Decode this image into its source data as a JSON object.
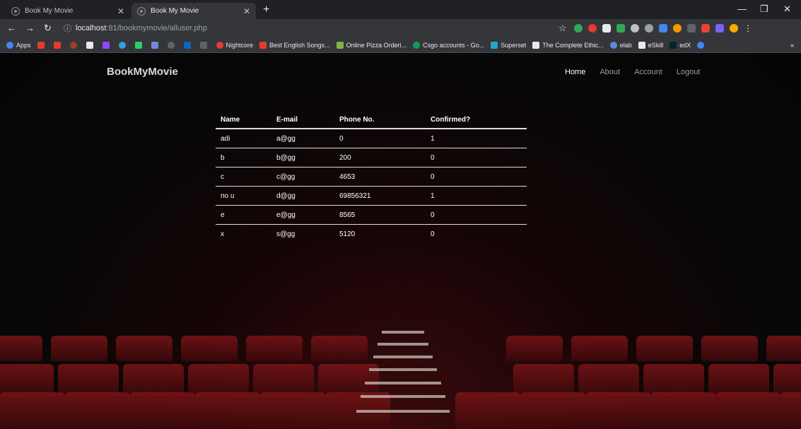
{
  "browser": {
    "tabs": [
      {
        "title": "Book My Movie",
        "active": false
      },
      {
        "title": "Book My Movie",
        "active": true
      }
    ],
    "url_host": "localhost",
    "url_path": ":81/bookmymovie/alluser.php",
    "bookmarks": [
      {
        "label": "Apps",
        "color": "#4285f4"
      },
      {
        "label": "",
        "color": "#e53935"
      },
      {
        "label": "",
        "color": "#e53935"
      },
      {
        "label": "",
        "color": "#9e3e29"
      },
      {
        "label": "",
        "color": "#e8eaed"
      },
      {
        "label": "",
        "color": "#9147ff"
      },
      {
        "label": "",
        "color": "#2aa3e1"
      },
      {
        "label": "",
        "color": "#25d366"
      },
      {
        "label": "",
        "color": "#7289da"
      },
      {
        "label": "",
        "color": "#5f6368"
      },
      {
        "label": "",
        "color": "#0a66c2"
      },
      {
        "label": "",
        "color": "#5f6368"
      },
      {
        "label": "Nightcore",
        "color": "#e53935"
      },
      {
        "label": "Best English Songs...",
        "color": "#e53935"
      },
      {
        "label": "Online Pizza Orderi...",
        "color": "#7cb342"
      },
      {
        "label": "Csgo accounts - Go...",
        "color": "#0f9d58"
      },
      {
        "label": "Superset",
        "color": "#20a7c9"
      },
      {
        "label": "The Complete Ethic...",
        "color": "#e8eaed"
      },
      {
        "label": "elab",
        "color": "#5c8bd6"
      },
      {
        "label": "eSkill",
        "color": "#e8eaed"
      },
      {
        "label": "edX",
        "color": "#02262b"
      },
      {
        "label": "",
        "color": "#4285f4"
      }
    ],
    "bookmarks_more": "»"
  },
  "site": {
    "brand": "BookMyMovie",
    "nav": [
      {
        "label": "Home",
        "active": true
      },
      {
        "label": "About",
        "active": false
      },
      {
        "label": "Account",
        "active": false
      },
      {
        "label": "Logout",
        "active": false
      }
    ]
  },
  "users_table": {
    "headers": [
      "Name",
      "E-mail",
      "Phone No.",
      "Confirmed?"
    ],
    "rows": [
      [
        "adi",
        "a@gg",
        "0",
        "1"
      ],
      [
        "b",
        "b@gg",
        "200",
        "0"
      ],
      [
        "c",
        "c@gg",
        "4653",
        "0"
      ],
      [
        "no u",
        "d@gg",
        "69856321",
        "1"
      ],
      [
        "e",
        "e@gg",
        "8565",
        "0"
      ],
      [
        "x",
        "s@gg",
        "5120",
        "0"
      ]
    ]
  }
}
